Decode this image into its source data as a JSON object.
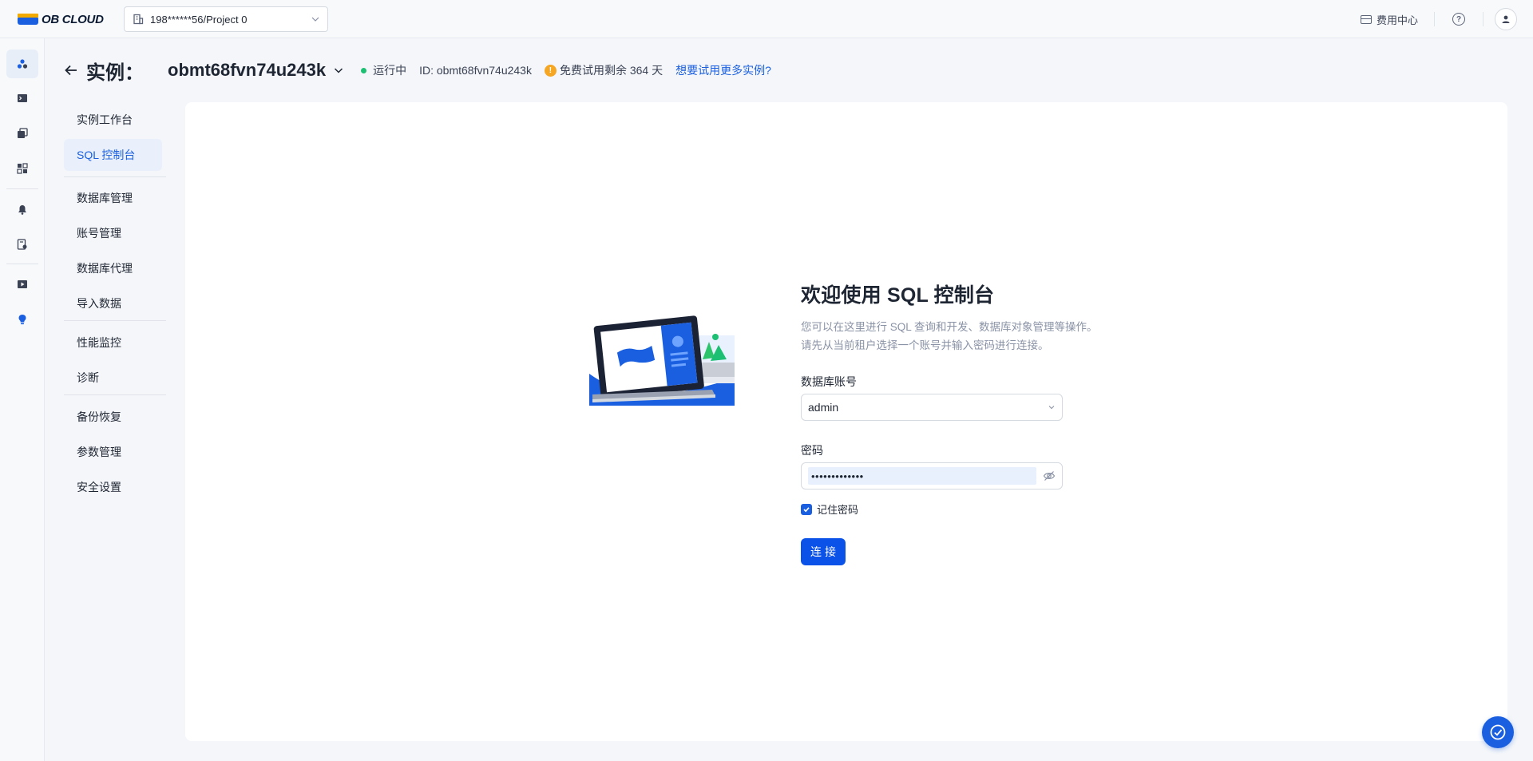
{
  "topbar": {
    "logo_text": "OB CLOUD",
    "project_select": "198******56/Project 0",
    "billing_label": "费用中心"
  },
  "header": {
    "label": "实例：",
    "instance_name": "obmt68fvn74u243k",
    "status": "运行中",
    "id_text": "ID: obmt68fvn74u243k",
    "trial_text": "免费试用剩余 364 天",
    "trial_link": "想要试用更多实例?"
  },
  "submenu": {
    "items": [
      {
        "label": "实例工作台"
      },
      {
        "label": "SQL 控制台"
      },
      {
        "label": "数据库管理"
      },
      {
        "label": "账号管理"
      },
      {
        "label": "数据库代理"
      },
      {
        "label": "导入数据"
      },
      {
        "label": "性能监控"
      },
      {
        "label": "诊断"
      },
      {
        "label": "备份恢复"
      },
      {
        "label": "参数管理"
      },
      {
        "label": "安全设置"
      }
    ]
  },
  "console": {
    "title": "欢迎使用 SQL 控制台",
    "desc_line1": "您可以在这里进行 SQL 查询和开发、数据库对象管理等操作。",
    "desc_line2": "请先从当前租户选择一个账号并输入密码进行连接。",
    "account_label": "数据库账号",
    "account_value": "admin",
    "password_label": "密码",
    "password_value": "•••••••••••••",
    "remember_label": "记住密码",
    "connect_label": "连接"
  },
  "colors": {
    "accent": "#1a5fe0",
    "status_running": "#1dbf73",
    "warning": "#f5a623"
  }
}
